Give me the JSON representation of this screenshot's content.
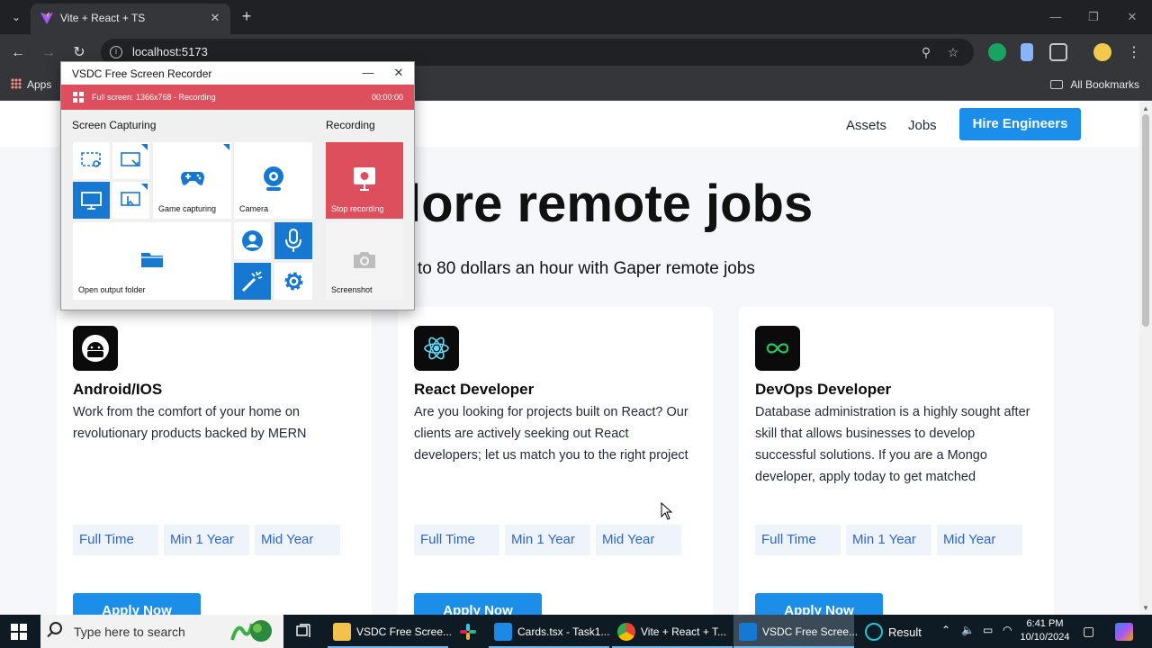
{
  "browser": {
    "tab_title": "Vite + React + TS",
    "url": "localhost:5173",
    "bookmark_apps": "Apps",
    "bookmark_all": "All Bookmarks"
  },
  "site": {
    "nav": {
      "assets": "Assets",
      "jobs": "Jobs",
      "hire": "Hire Engineers"
    },
    "hero_title": "lore remote jobs",
    "hero_subtitle": "to 80 dollars an hour with Gaper remote jobs",
    "cards": [
      {
        "title": "Android/IOS",
        "description": "Work from the comfort of your home on revolutionary products backed by MERN",
        "tags": [
          "Full Time",
          "Min 1 Year",
          "Mid Year"
        ],
        "apply": "Apply Now",
        "logo": "android-icon"
      },
      {
        "title": "React Developer",
        "description": "Are you looking for projects built on React? Our clients are actively seeking out React developers; let us match you to the right project",
        "tags": [
          "Full Time",
          "Min 1 Year",
          "Mid Year"
        ],
        "apply": "Apply Now",
        "logo": "react-icon"
      },
      {
        "title": "DevOps Developer",
        "description": "Database administration is a highly sought after skill that allows businesses to develop successful solutions. If you are a Mongo developer, apply today to get matched",
        "tags": [
          "Full Time",
          "Min 1 Year",
          "Mid Year"
        ],
        "apply": "Apply Now",
        "logo": "infinity-icon"
      }
    ]
  },
  "recorder": {
    "title": "VSDC Free Screen Recorder",
    "status": "Full screen: 1366x768 - Recording",
    "timer": "00:00:00",
    "section_capture": "Screen Capturing",
    "section_recording": "Recording",
    "tiles": {
      "game": "Game capturing",
      "camera": "Camera",
      "stop": "Stop recording",
      "folder": "Open output folder",
      "screenshot": "Screenshot"
    }
  },
  "taskbar": {
    "search_placeholder": "Type here to search",
    "items": [
      {
        "label": "VSDC Free Scree...",
        "icon": "folder-icon"
      },
      {
        "label": "Cards.tsx - Task1...",
        "icon": "vscode-icon"
      },
      {
        "label": "Vite + React + T...",
        "icon": "chrome-icon"
      },
      {
        "label": "VSDC Free Scree...",
        "icon": "vsdc-icon"
      },
      {
        "label": "Result",
        "icon": "result-icon"
      }
    ],
    "time": "6:41 PM",
    "date": "10/10/2024"
  },
  "colors": {
    "accent": "#1a8ee8",
    "recording": "#de4f5e",
    "tile_blue": "#1778d1",
    "tag_bg": "#eef3fc",
    "tag_text": "#2e66c4"
  }
}
